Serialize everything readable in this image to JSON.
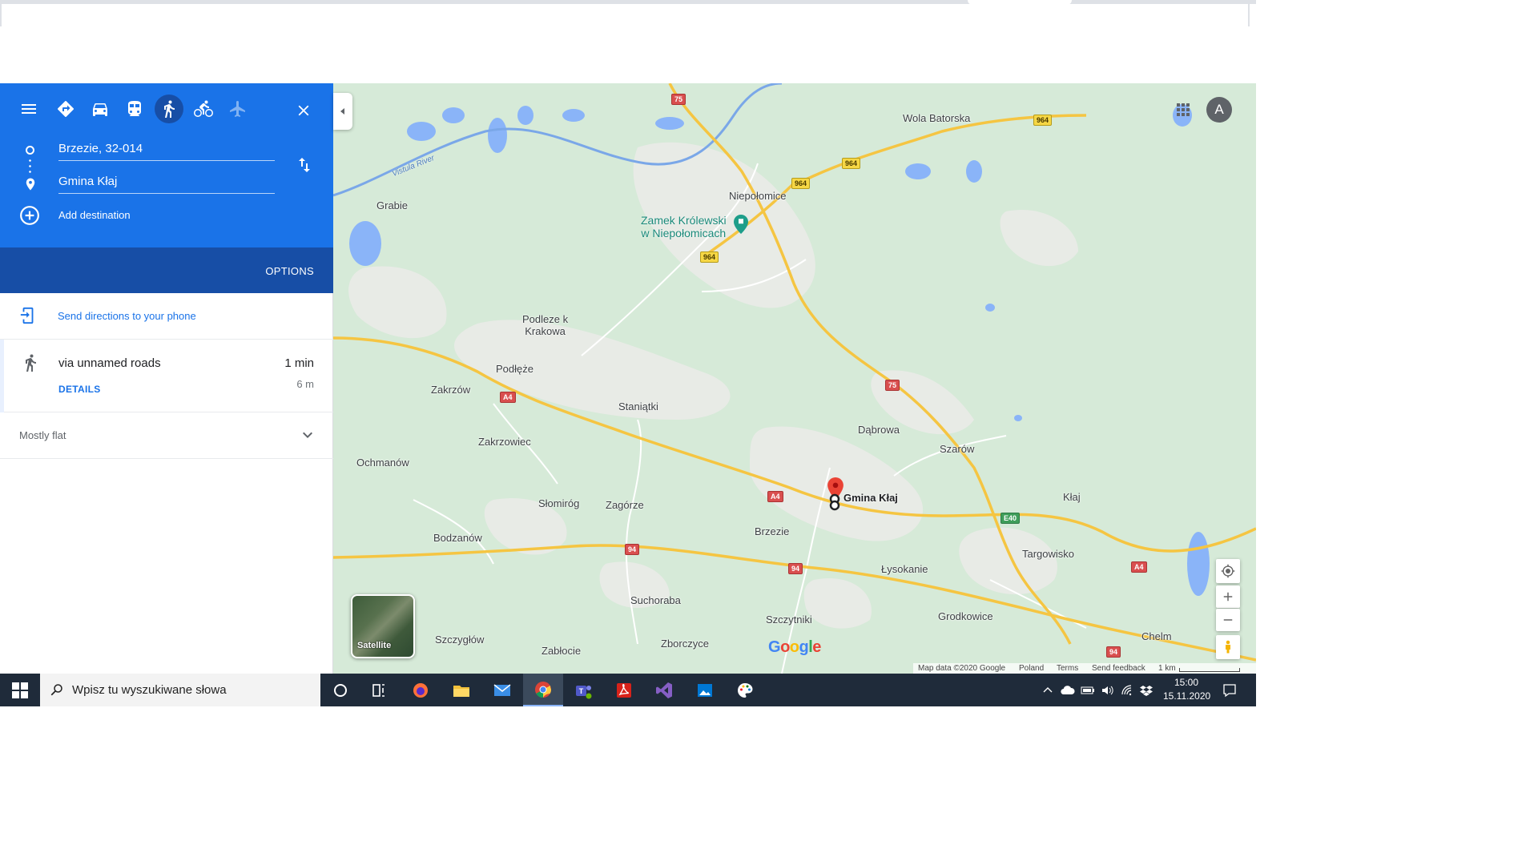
{
  "sidebar": {
    "modes": [
      "Best travel modes",
      "Driving",
      "Transit",
      "Walking",
      "Cycling",
      "Flights"
    ],
    "origin": "Brzezie, 32-014",
    "destination": "Gmina Kłaj",
    "add_destination": "Add destination",
    "options_label": "OPTIONS",
    "send_directions": "Send directions to your phone",
    "route": {
      "via": "via unnamed roads",
      "time": "1 min",
      "distance": "6 m",
      "details": "DETAILS"
    },
    "elevation": "Mostly flat"
  },
  "map": {
    "places": {
      "wola_batorska": "Wola Batorska",
      "niepolomice": "Niepołomice",
      "grabie": "Grabie",
      "podleze_k_krakowa": "Podleze k\nKrakowa",
      "podleze": "Podłęże",
      "zakrzow": "Zakrzów",
      "staniatki": "Staniątki",
      "dabrowa": "Dąbrowa",
      "szarow": "Szarów",
      "zakrzowiec": "Zakrzowiec",
      "ochmanow": "Ochmanów",
      "slomirog": "Słomiróg",
      "zagorze": "Zagórze",
      "klaj": "Kłaj",
      "brzezie": "Brzezie",
      "bodzanow": "Bodzanów",
      "targowisko": "Targowisko",
      "lysokanie": "Łysokanie",
      "suchoraba": "Suchoraba",
      "grodkowice": "Grodkowice",
      "szczytniki": "Szczytniki",
      "chelm": "Chelm",
      "szczyglow": "Szczygłów",
      "zborczyce": "Zborczyce",
      "zablocie": "Zabłocie"
    },
    "poi": "Zamek Królewski\nw Niepołomicach",
    "river": "Vistula River",
    "shields": {
      "r75a": "75",
      "r75b": "75",
      "r964a": "964",
      "r964b": "964",
      "r964c": "964",
      "r964d": "964",
      "a4a": "A4",
      "a4b": "A4",
      "a4c": "A4",
      "e40": "E40",
      "r94a": "94",
      "r94b": "94",
      "r94c": "94"
    },
    "marker_label": "Gmina Kłaj",
    "satellite_label": "Satellite",
    "avatar_letter": "A",
    "google_logo": "Google",
    "attribution": {
      "data": "Map data ©2020 Google",
      "country": "Poland",
      "terms": "Terms",
      "feedback": "Send feedback",
      "scale": "1 km"
    }
  },
  "taskbar": {
    "search_placeholder": "Wpisz tu wyszukiwane słowa",
    "time": "15:00",
    "date": "15.11.2020"
  },
  "colors": {
    "accent": "#1a73e8",
    "accent_dark": "#174ea6",
    "map_bg": "#d6ead8",
    "road": "#f5c542"
  }
}
